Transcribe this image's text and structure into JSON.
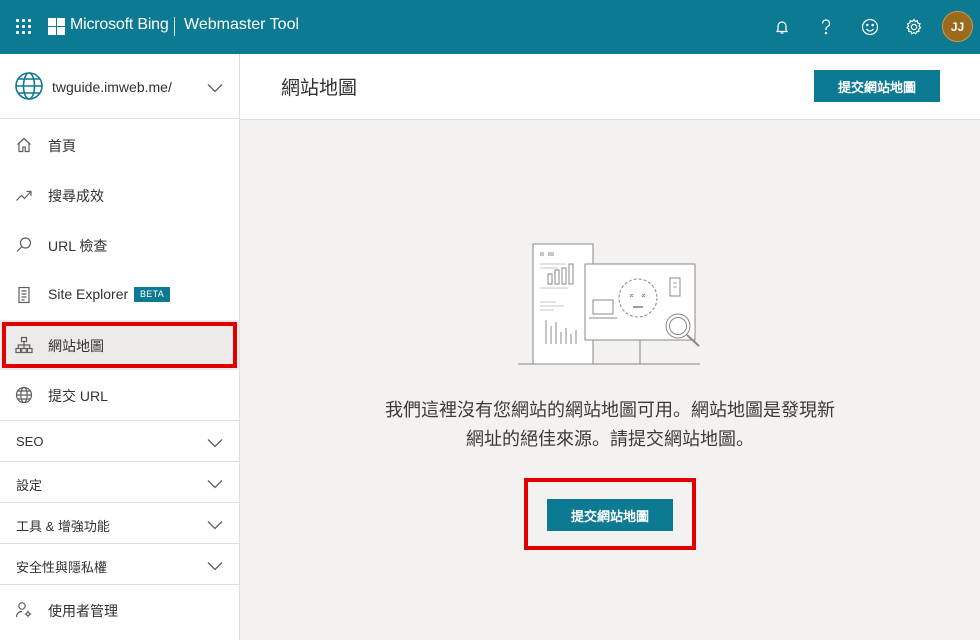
{
  "header": {
    "brand": "Microsoft Bing",
    "product": "Webmaster Tool",
    "avatar_initials": "JJ",
    "icons": [
      "waffle-icon",
      "bell-icon",
      "help-icon",
      "smiley-icon",
      "gear-icon"
    ]
  },
  "site_selector": {
    "value": "twguide.imweb.me/"
  },
  "nav": {
    "items": [
      {
        "label": "首頁",
        "icon": "home-icon"
      },
      {
        "label": "搜尋成效",
        "icon": "trend-icon"
      },
      {
        "label": "URL 檢查",
        "icon": "search-icon"
      },
      {
        "label": "Site Explorer",
        "icon": "document-icon",
        "badge": "BETA"
      },
      {
        "label": "網站地圖",
        "icon": "sitemap-icon",
        "active": true
      },
      {
        "label": "提交 URL",
        "icon": "globe-icon"
      }
    ],
    "sections": [
      {
        "label": "SEO"
      },
      {
        "label": "設定"
      },
      {
        "label": "工具 & 增強功能"
      },
      {
        "label": "安全性與隱私權"
      }
    ],
    "bottom_item": {
      "label": "使用者管理",
      "icon": "user-settings-icon"
    }
  },
  "main": {
    "title": "網站地圖",
    "header_button": "提交網站地圖",
    "empty_line1": "我們這裡沒有您網站的網站地圖可用。網站地圖是發現新",
    "empty_line2": "網址的絕佳來源。請提交網站地圖。",
    "body_button": "提交網站地圖"
  },
  "colors": {
    "accent": "#0c7a93",
    "highlight": "#e10000",
    "body_bg": "#f3f2f1"
  }
}
